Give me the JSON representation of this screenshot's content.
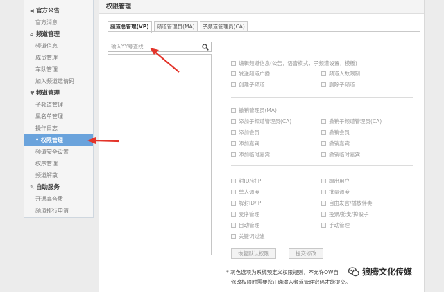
{
  "sidebar": {
    "groups": [
      {
        "title": "官方公告",
        "icon": "speaker-icon",
        "items": [
          "官方消息"
        ]
      },
      {
        "title": "频道管理",
        "icon": "home-icon",
        "items": [
          "频道信息",
          "成员管理",
          "车队管理",
          "加入频道邀请码"
        ]
      },
      {
        "title": "频道管理",
        "icon": "location-icon",
        "items": [
          "子频道管理",
          "黑名单管理",
          "操作日志",
          "权限管理",
          "频道安全设置",
          "权序管理",
          "频道解散"
        ]
      },
      {
        "title": "自助服务",
        "icon": "wrench-icon",
        "items": [
          "开通高音质",
          "频道排行申请"
        ]
      }
    ],
    "active_item": "权限管理"
  },
  "main": {
    "title": "权限管理",
    "tabs": [
      {
        "label": "频道总管理(VP)",
        "active": true
      },
      {
        "label": "频道管理员(MA)",
        "active": false
      },
      {
        "label": "子频道管理员(CA)",
        "active": false
      }
    ],
    "search": {
      "placeholder": "输入YY号查找"
    },
    "permissions": {
      "group1": [
        "编辑频道信息(公告，语音模式，子频道设置，模版)",
        "发送频道广播",
        "创建子频道",
        "频道人数限制",
        "删除子频道"
      ],
      "group2": [
        "撤销管理员(MA)",
        "添加子频道管理员(CA)",
        "撤销子频道管理员(CA)",
        "添加会员",
        "撤销会员",
        "添加嘉宾",
        "撤销嘉宾",
        "添加临时嘉宾",
        "撤销临时嘉宾"
      ],
      "group3": [
        "封ID/封IP",
        "踢出用户",
        "单人调度",
        "批量调度",
        "解封ID/IP",
        "自由发言/播放伴奏",
        "麦序管理",
        "投票/抢麦/掷骰子",
        "自动管理",
        "手动管理",
        "关键词过滤"
      ]
    },
    "buttons": {
      "restore": "恢复默认权限",
      "submit": "提交修改"
    },
    "notes": [
      "* 灰色选项为系统预定义权限规则，不允许OW自",
      "修改权限时需要您正确输入频道管理密码才能提交。"
    ]
  },
  "watermark": {
    "text": "狼腾文化传媒"
  },
  "colors": {
    "active_item_bg": "#6aa3dc",
    "annotation_arrow": "#e3342a",
    "border": "#c9c9c9"
  }
}
